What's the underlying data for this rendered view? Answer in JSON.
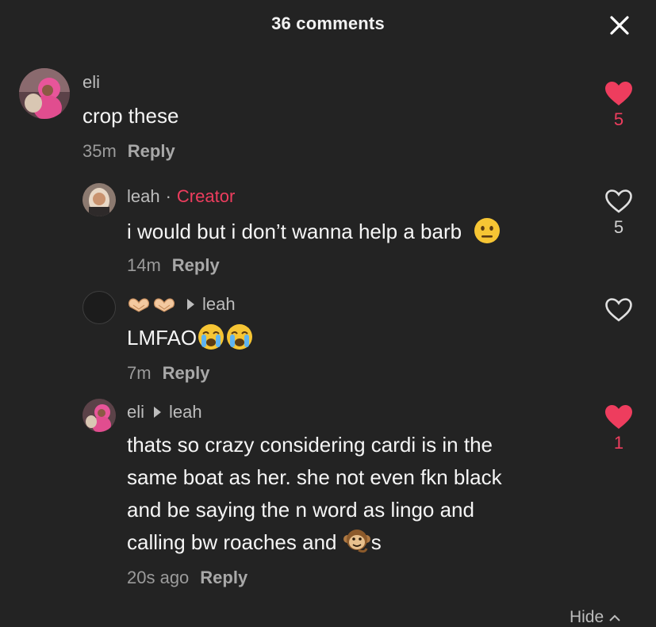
{
  "header": {
    "title": "36 comments"
  },
  "comments": [
    {
      "user": "eli",
      "text": "crop these",
      "time": "35m",
      "reply": "Reply",
      "likes": "5",
      "liked": true
    },
    {
      "user": "leah",
      "creator_label": "Creator",
      "text": "i would but i don’t wanna help a barb",
      "emoji": "neutral-face",
      "time": "14m",
      "reply": "Reply",
      "likes": "5",
      "liked": false
    },
    {
      "user_emoji": "heart-hands-icon",
      "reply_to": "leah",
      "text": "LMFAO",
      "emoji": "crying-face",
      "time": "7m",
      "reply": "Reply",
      "liked": false
    },
    {
      "user": "eli",
      "reply_to": "leah",
      "lines": [
        "thats so crazy considering cardi is in the",
        "same boat as her. she not even fkn black",
        "and be saying the n word as lingo and",
        "calling bw roaches and",
        "s"
      ],
      "emoji": "monkey-face",
      "time": "20s ago",
      "reply": "Reply",
      "likes": "1",
      "liked": true
    }
  ],
  "footer": {
    "hide_label": "Hide"
  },
  "colors": {
    "accent": "#ee3d5e",
    "background": "#232323"
  }
}
